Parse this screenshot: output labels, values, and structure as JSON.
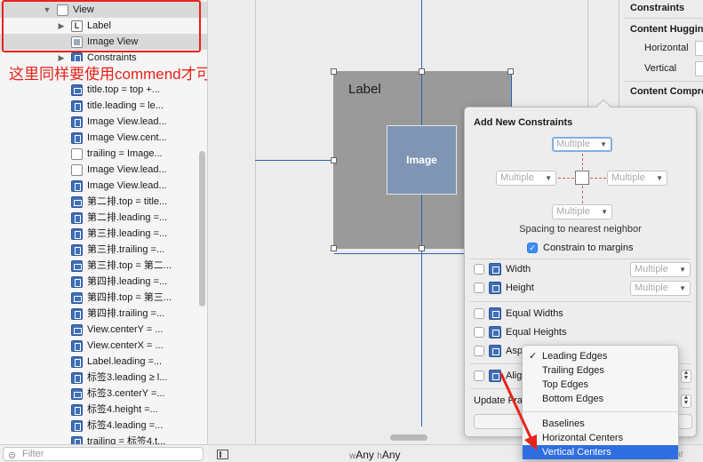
{
  "outline": {
    "rows": [
      {
        "label": "View",
        "type": "view",
        "indent": 0,
        "disclosure": "open",
        "selected": true
      },
      {
        "label": "Label",
        "type": "label",
        "indent": 1,
        "disclosure": "closed",
        "selected": false
      },
      {
        "label": "Image View",
        "type": "image",
        "indent": 1,
        "disclosure": "",
        "selected": true
      },
      {
        "label": "Constraints",
        "type": "constraint",
        "indent": 1,
        "disclosure": "closed",
        "selected": false
      },
      {
        "label": "",
        "type": "constraint",
        "indent": 0,
        "disclosure": "",
        "selected": false
      },
      {
        "label": "title.top = top +...",
        "type": "constraint-v",
        "indent": 0,
        "selected": false
      },
      {
        "label": "title.leading = le...",
        "type": "constraint",
        "indent": 0,
        "selected": false
      },
      {
        "label": "Image View.lead...",
        "type": "constraint",
        "indent": 0,
        "selected": false
      },
      {
        "label": "Image View.cent...",
        "type": "constraint",
        "indent": 0,
        "selected": false
      },
      {
        "label": "trailing = Image...",
        "type": "constraint-grey",
        "indent": 0,
        "selected": false
      },
      {
        "label": "Image View.lead...",
        "type": "constraint-grey",
        "indent": 0,
        "selected": false
      },
      {
        "label": "Image View.lead...",
        "type": "constraint",
        "indent": 0,
        "selected": false
      },
      {
        "label": "第二排.top = title...",
        "type": "constraint-v",
        "indent": 0,
        "selected": false
      },
      {
        "label": "第二排.leading =...",
        "type": "constraint",
        "indent": 0,
        "selected": false
      },
      {
        "label": "第三排.leading =...",
        "type": "constraint",
        "indent": 0,
        "selected": false
      },
      {
        "label": "第三排.trailing =...",
        "type": "constraint",
        "indent": 0,
        "selected": false
      },
      {
        "label": "第三排.top = 第二...",
        "type": "constraint-v",
        "indent": 0,
        "selected": false
      },
      {
        "label": "第四排.leading =...",
        "type": "constraint",
        "indent": 0,
        "selected": false
      },
      {
        "label": "第四排.top = 第三...",
        "type": "constraint-v",
        "indent": 0,
        "selected": false
      },
      {
        "label": "第四排.trailing =...",
        "type": "constraint",
        "indent": 0,
        "selected": false
      },
      {
        "label": "View.centerY = ...",
        "type": "constraint-v",
        "indent": 0,
        "selected": false
      },
      {
        "label": "View.centerX = ...",
        "type": "constraint",
        "indent": 0,
        "selected": false
      },
      {
        "label": "Label.leading =...",
        "type": "constraint",
        "indent": 0,
        "selected": false
      },
      {
        "label": "标签3.leading ≥ l...",
        "type": "constraint",
        "indent": 0,
        "selected": false
      },
      {
        "label": "标签3.centerY =...",
        "type": "constraint-v",
        "indent": 0,
        "selected": false
      },
      {
        "label": "标签4.height =...",
        "type": "constraint",
        "indent": 0,
        "selected": false
      },
      {
        "label": "标签4.leading =...",
        "type": "constraint",
        "indent": 0,
        "selected": false
      },
      {
        "label": "trailing = 标签4.t...",
        "type": "constraint",
        "indent": 0,
        "selected": false
      }
    ],
    "filter_placeholder": "Filter",
    "filter_icon": "filter-icon"
  },
  "annotation": {
    "note": "这里同样要使用commend才可选中",
    "color": "#e8231a"
  },
  "canvas": {
    "label_text": "Label",
    "image_text": "Image"
  },
  "inspector": {
    "constraints_header": "Constraints",
    "hugging_header": "Content Hugging",
    "horizontal_label": "Horizontal",
    "vertical_label": "Vertical",
    "compression_header": "Content Compre"
  },
  "bottom_bar": {
    "w_prefix": "w",
    "w_value": "Any",
    "h_prefix": "h",
    "h_value": "Any",
    "right_text": "ar"
  },
  "popover": {
    "title": "Add New Constraints",
    "top_value": "Multiple",
    "left_value": "Multiple",
    "right_value": "Multiple",
    "bottom_value": "Multiple",
    "spacing_text": "Spacing to nearest neighbor",
    "constrain_margins_label": "Constrain to margins",
    "constrain_margins_checked": true,
    "width_label": "Width",
    "width_value": "Multiple",
    "height_label": "Height",
    "height_value": "Multiple",
    "equal_widths_label": "Equal Widths",
    "equal_heights_label": "Equal Heights",
    "aspect_label": "Asp",
    "align_label": "Alig",
    "update_frames_label": "Update Fra"
  },
  "menu": {
    "items": [
      {
        "label": "Leading Edges",
        "checked": true,
        "active": false
      },
      {
        "label": "Trailing Edges",
        "checked": false,
        "active": false
      },
      {
        "label": "Top Edges",
        "checked": false,
        "active": false
      },
      {
        "label": "Bottom Edges",
        "checked": false,
        "active": false
      },
      {
        "label": "Baselines",
        "checked": false,
        "active": false
      },
      {
        "label": "Horizontal Centers",
        "checked": false,
        "active": false
      },
      {
        "label": "Vertical Centers",
        "checked": false,
        "active": true
      }
    ],
    "accent_color": "#2f6ee0"
  }
}
